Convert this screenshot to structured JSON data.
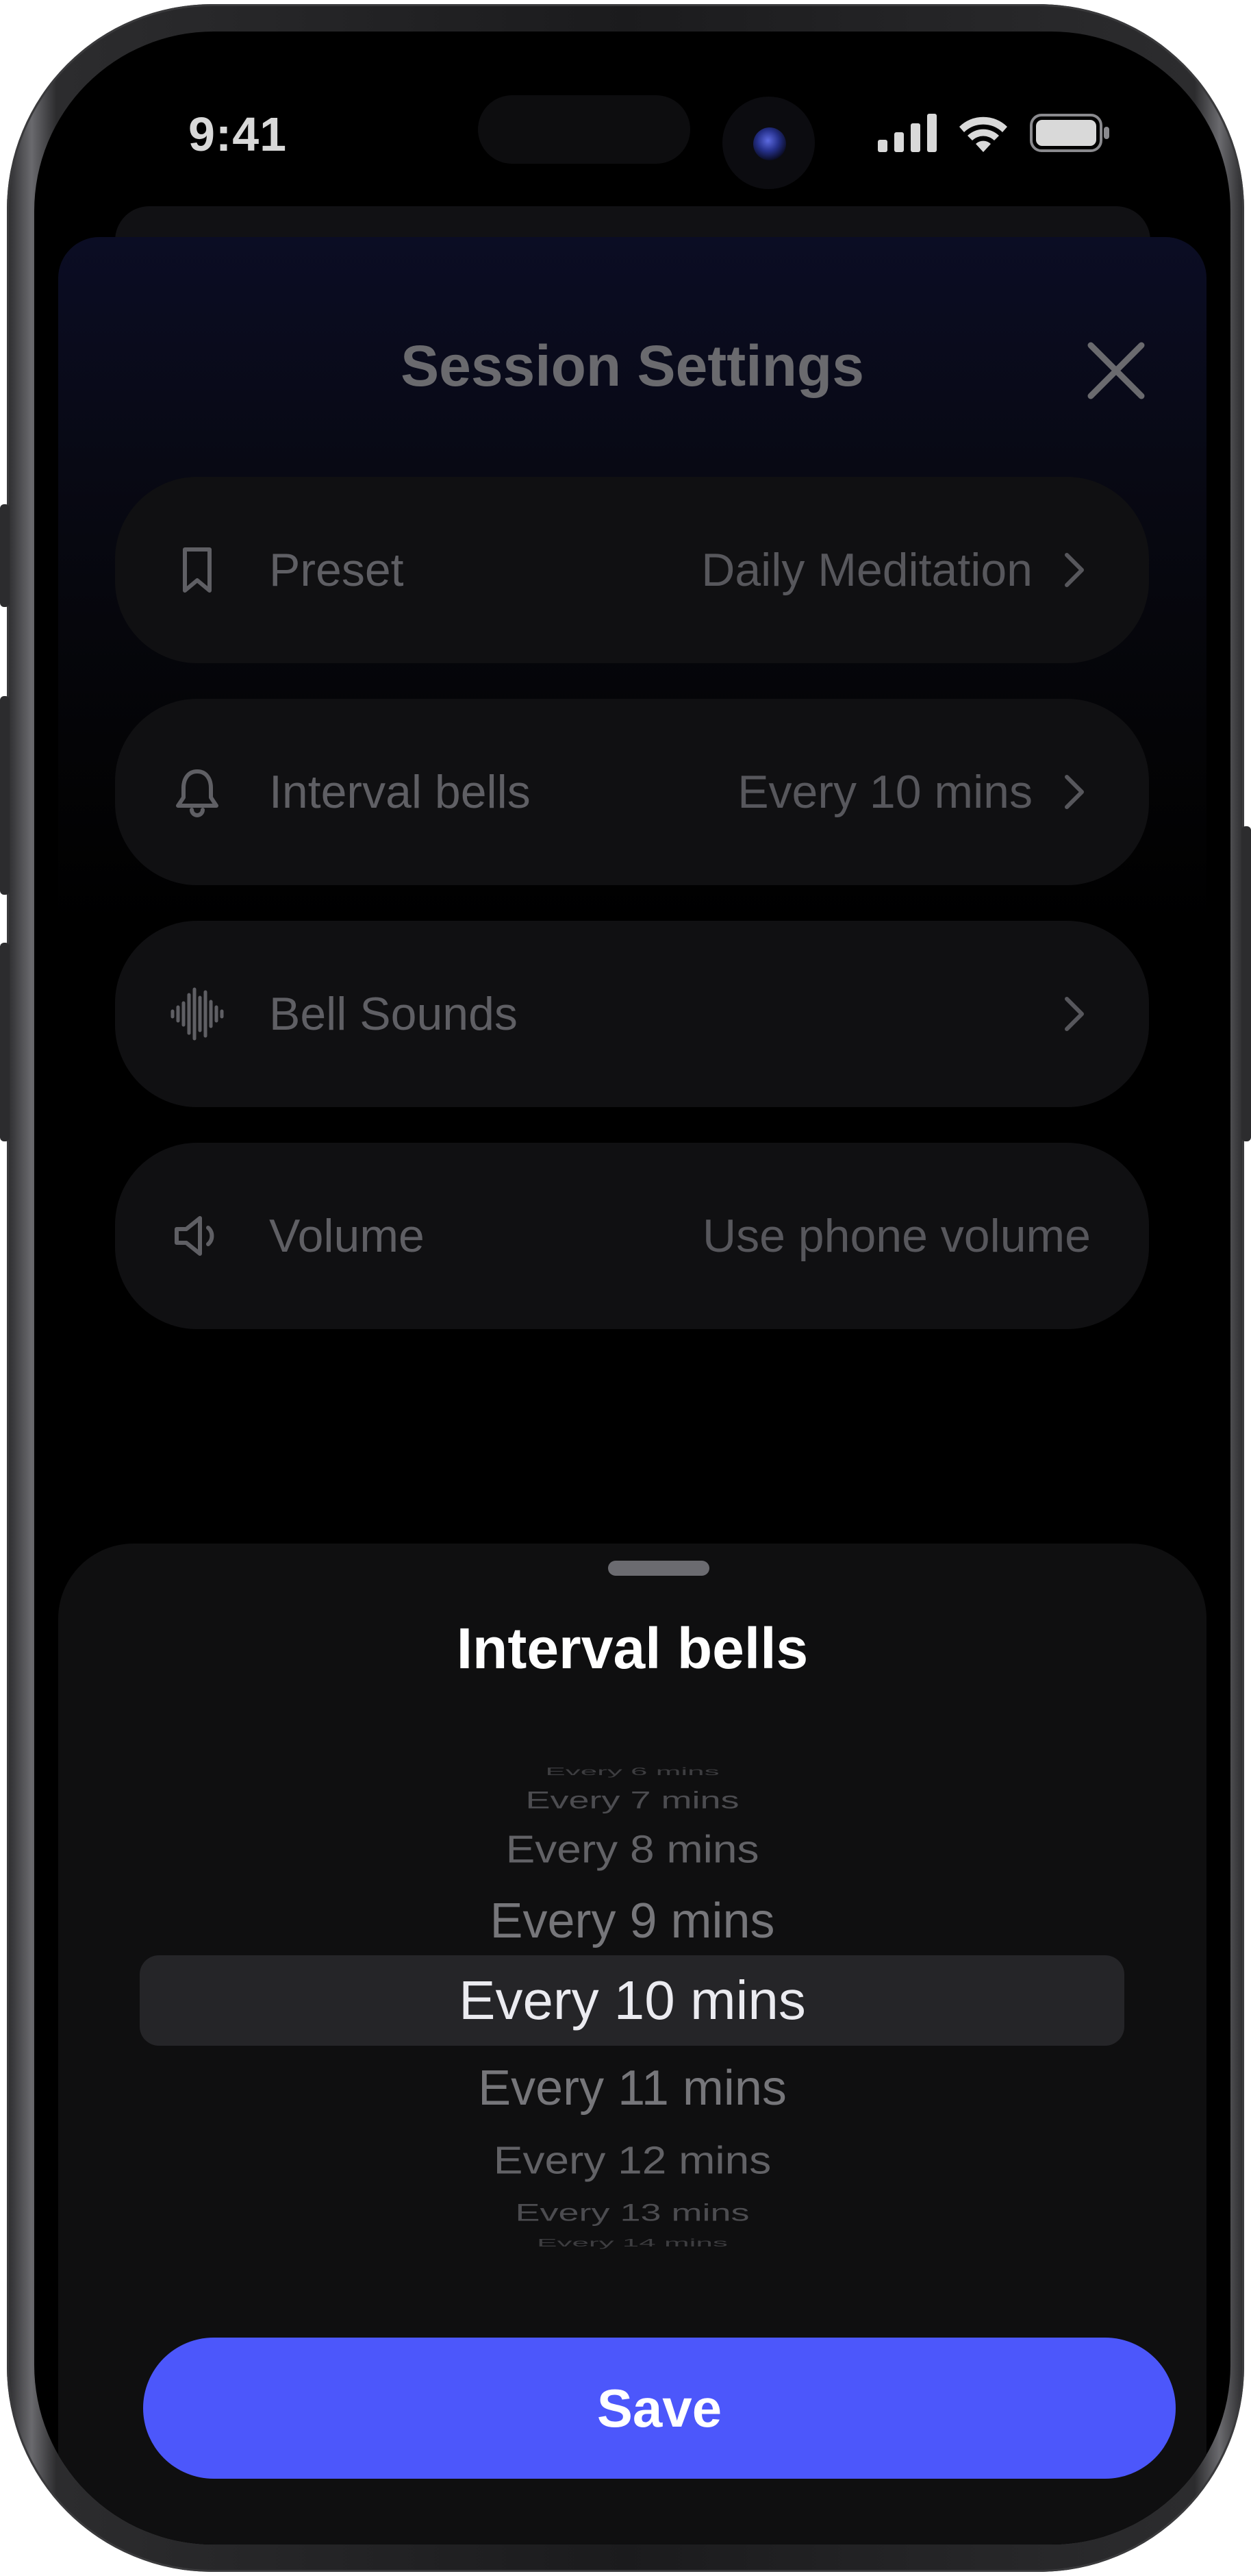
{
  "status_bar": {
    "time": "9:41",
    "icons": [
      "cellular-signal-icon",
      "wifi-icon",
      "battery-icon"
    ]
  },
  "settings_sheet": {
    "title": "Session Settings",
    "close_icon": "close-icon",
    "rows": [
      {
        "icon": "bookmark-icon",
        "label": "Preset",
        "value": "Daily Meditation",
        "chevron": true
      },
      {
        "icon": "bell-icon",
        "label": "Interval bells",
        "value": "Every 10 mins",
        "chevron": true
      },
      {
        "icon": "sound-wave-icon",
        "label": "Bell Sounds",
        "value": "",
        "chevron": true
      },
      {
        "icon": "speaker-icon",
        "label": "Volume",
        "value": "Use phone volume",
        "chevron": false
      }
    ]
  },
  "picker_sheet": {
    "title": "Interval bells",
    "options": [
      "Every 6 mins",
      "Every 7 mins",
      "Every 8 mins",
      "Every 9 mins",
      "Every 10 mins",
      "Every 11 mins",
      "Every 12 mins",
      "Every 13 mins",
      "Every 14 mins"
    ],
    "selected": "Every 10 mins",
    "save_label": "Save"
  },
  "colors": {
    "accent": "#4c57fb",
    "sheet_background": "#0f0f10",
    "row_background": "#101012",
    "selected_row": "#252528"
  }
}
